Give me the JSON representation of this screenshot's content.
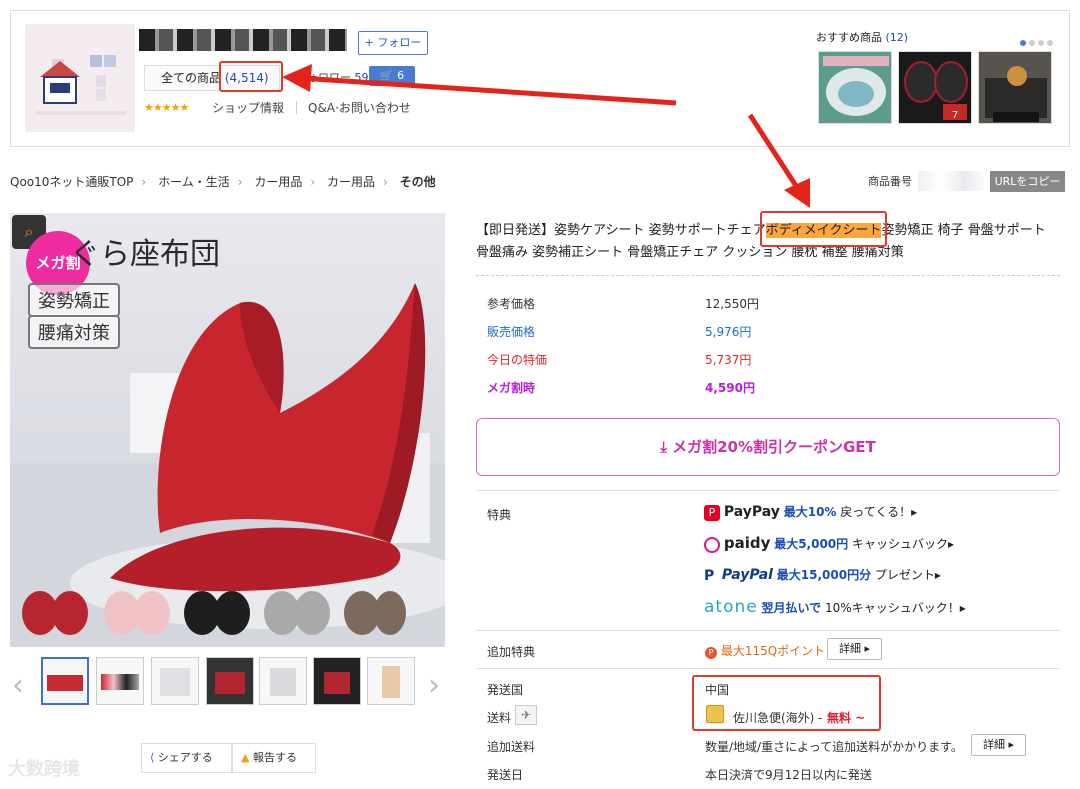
{
  "shop": {
    "follow_label": "+ フォロー",
    "all_items_label": "全ての商品",
    "all_items_count": "(4,514)",
    "follower_text": "フォロワー",
    "follower_count": "597",
    "cart_count": "6",
    "shop_info_label": "ショップ情報",
    "qa_label": "Q&A·お問い合わせ",
    "recommend_title": "おすすめ商品",
    "recommend_count": "(12)",
    "rec_badge": "7"
  },
  "breadcrumb": [
    "Qoo10ネット通販TOP",
    "ホーム・生活",
    "カー用品",
    "カー用品",
    "その他"
  ],
  "product_no_label": "商品番号",
  "copy_url_label": "URLをコピー",
  "main_image": {
    "mega_badge": "メガ割",
    "heading": "ぐら座布団",
    "tag1": "姿勢矯正",
    "tag2": "腰痛対策"
  },
  "title": {
    "before": "【即日発送】姿勢ケアシート 姿勢サポートチェア",
    "highlight": "ボディメイクシート",
    "after": "姿勢矯正 椅子 骨盤サポート 骨盤痛み 姿勢補正シート 骨盤矯正チェア クッション 腰枕 補整 腰痛対策"
  },
  "prices": [
    {
      "label": "参考価格",
      "value": "12,550円",
      "color": "#333333"
    },
    {
      "label": "販売価格",
      "value": "5,976円",
      "color": "#1d6fc9"
    },
    {
      "label": "今日の特価",
      "value": "5,737円",
      "color": "#e0232b"
    },
    {
      "label": "メガ割時",
      "value": "4,590円",
      "color": "#b51fd3"
    }
  ],
  "coupon_label": "メガ割20%割引クーポンGET",
  "benefits": {
    "label": "特典",
    "paypay": {
      "brand": "PayPay",
      "strong": "最大10%",
      "rest": "戻ってくる！▸"
    },
    "paidy": {
      "brand": "paidy",
      "strong": "最大5,000円",
      "rest": "キャッシュバック▸"
    },
    "paypal": {
      "brand": "PayPal",
      "strong": "最大15,000円分",
      "rest": "プレゼント▸"
    },
    "atone": {
      "brand": "atone",
      "strong": "翌月払いで",
      "rest": "10%キャッシュバック！▸"
    }
  },
  "extra_benefit": {
    "label": "追加特典",
    "value": "最大115Qポイント",
    "button": "詳細 ▸"
  },
  "shipping": {
    "country_label": "発送国",
    "country_value": "中国",
    "fee_label": "送料",
    "carrier": "佐川急便(海外) -",
    "free": "無料 ~",
    "extra_label": "追加送料",
    "extra_value": "数量/地域/重さによって追加送料がかかります。",
    "extra_button": "詳細 ▸",
    "date_label": "発送日",
    "date_value": "本日決済で9月12日以内に発送"
  },
  "share_label": "シェアする",
  "report_label": "報告する",
  "watermark": "大数跨境",
  "colors": {
    "accent": "#1d4bb8",
    "sale": "#e0232b",
    "mega": "#b51fd3",
    "annotation": "#e03a2e",
    "highlight": "#ffa53d"
  }
}
